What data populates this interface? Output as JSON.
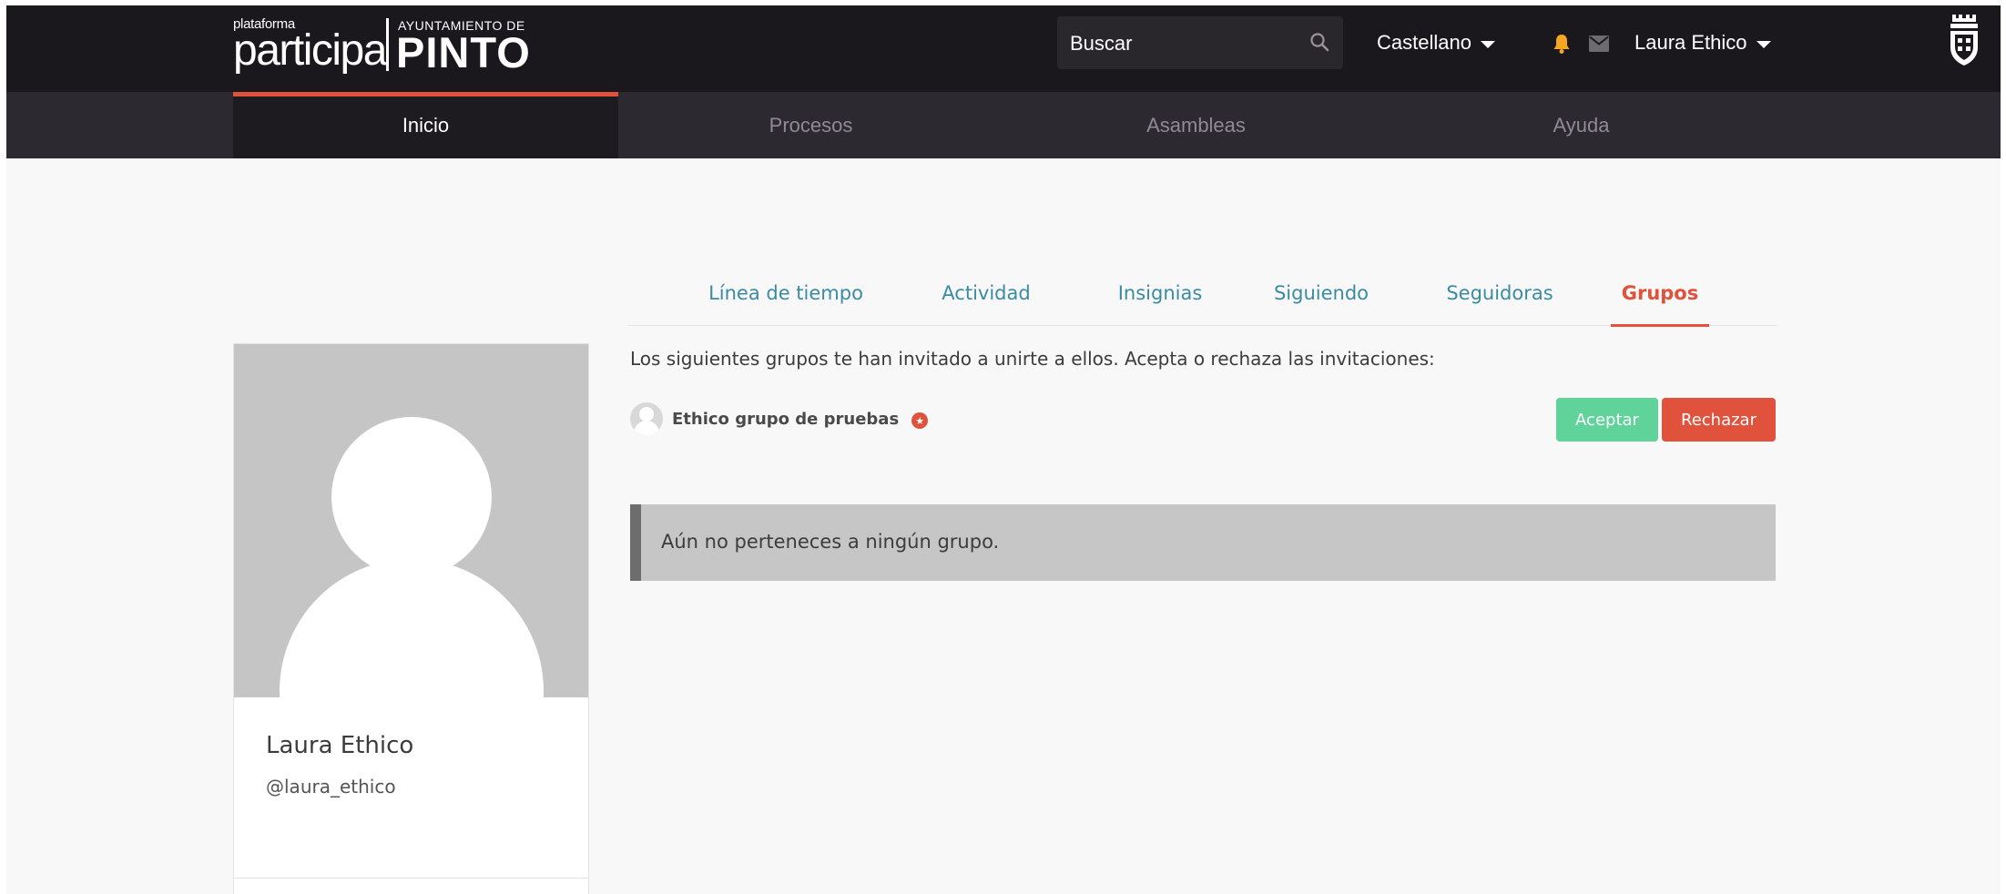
{
  "header": {
    "logo": {
      "small": "plataforma",
      "main": "participa",
      "org_top": "AYUNTAMIENTO DE",
      "org_main": "PINTO"
    },
    "search": {
      "label": "Buscar",
      "icon": "search-icon"
    },
    "language": {
      "label": "Castellano",
      "icon": "chevron-down-icon"
    },
    "notifications": {
      "icon": "bell-icon",
      "color": "#f5a623"
    },
    "messages": {
      "icon": "envelope-icon"
    },
    "user": {
      "label": "Laura Ethico",
      "icon": "chevron-down-icon"
    },
    "crest": {
      "icon": "coat-of-arms-icon"
    }
  },
  "nav": {
    "items": [
      {
        "label": "Inicio",
        "active": true
      },
      {
        "label": "Procesos",
        "active": false
      },
      {
        "label": "Asambleas",
        "active": false
      },
      {
        "label": "Ayuda",
        "active": false
      }
    ]
  },
  "profile": {
    "name": "Laura Ethico",
    "handle": "@laura_ethico"
  },
  "tabs": {
    "items": [
      {
        "label": "Línea de tiempo",
        "active": false
      },
      {
        "label": "Actividad",
        "active": false
      },
      {
        "label": "Insignias",
        "active": false
      },
      {
        "label": "Siguiendo",
        "active": false
      },
      {
        "label": "Seguidoras",
        "active": false
      },
      {
        "label": "Grupos",
        "active": true
      }
    ]
  },
  "groups": {
    "invite_text": "Los siguientes grupos te han invitado a unirte a ellos. Acepta o rechaza las invitaciones:",
    "invitations": [
      {
        "name": "Ethico grupo de pruebas",
        "verified": true
      }
    ],
    "accept_label": "Aceptar",
    "reject_label": "Rechazar",
    "empty_notice": "Aún no perteneces a ningún grupo."
  },
  "colors": {
    "accent": "#e0523b",
    "link": "#3a8ba3",
    "accept": "#5fd39a",
    "header_bg": "#1b181d",
    "nav_bg": "#2c2930"
  }
}
